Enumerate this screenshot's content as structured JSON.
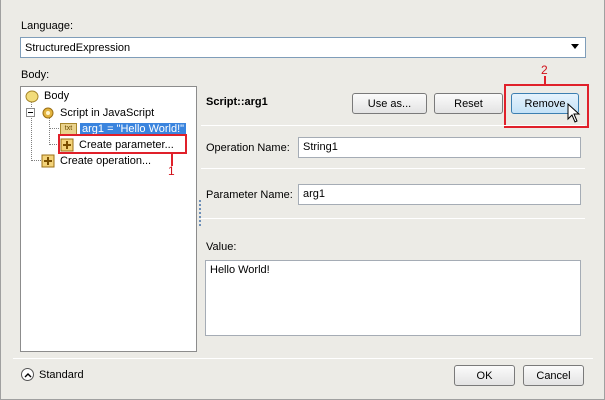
{
  "language": {
    "label": "Language:",
    "value": "StructuredExpression"
  },
  "body": {
    "label": "Body:",
    "tree": [
      {
        "label": "Body",
        "icon": "folder-icon"
      },
      {
        "label": "Script in JavaScript",
        "icon": "gear-icon"
      },
      {
        "label": "arg1 = \"Hello World!\"",
        "icon": "txt-icon",
        "icon_text": "txt",
        "selected": true
      },
      {
        "label": "Create parameter...",
        "icon": "plus-icon"
      },
      {
        "label": "Create operation...",
        "icon": "plus-icon"
      }
    ]
  },
  "detail": {
    "title": "Script::arg1",
    "use_as_label": "Use as...",
    "reset_label": "Reset",
    "remove_label": "Remove",
    "operation_name_label": "Operation Name:",
    "operation_name_value": "String1",
    "parameter_name_label": "Parameter Name:",
    "parameter_name_value": "arg1",
    "value_label": "Value:",
    "value_text": "Hello World!"
  },
  "callouts": {
    "one": "1",
    "two": "2"
  },
  "footer": {
    "standard_label": "Standard",
    "ok_label": "OK",
    "cancel_label": "Cancel"
  },
  "colors": {
    "selection": "#3a84de",
    "callout": "#e0202a"
  }
}
